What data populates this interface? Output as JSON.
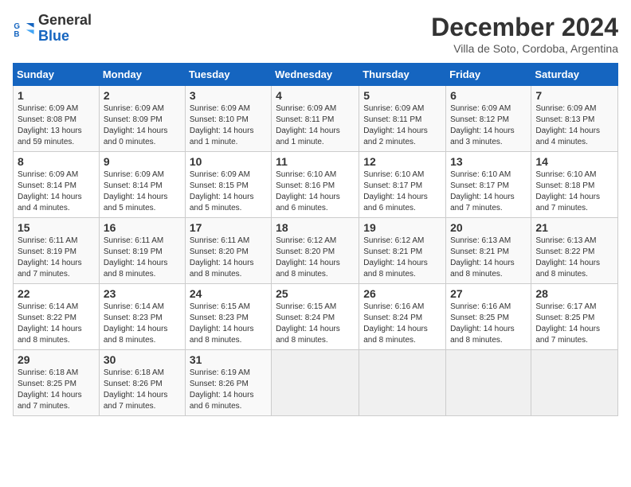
{
  "header": {
    "logo_line1": "General",
    "logo_line2": "Blue",
    "month_title": "December 2024",
    "subtitle": "Villa de Soto, Cordoba, Argentina"
  },
  "calendar": {
    "days_of_week": [
      "Sunday",
      "Monday",
      "Tuesday",
      "Wednesday",
      "Thursday",
      "Friday",
      "Saturday"
    ],
    "weeks": [
      [
        null,
        null,
        null,
        null,
        null,
        null,
        null
      ]
    ],
    "cells": [
      {
        "day": null
      },
      {
        "day": null
      },
      {
        "day": null
      },
      {
        "day": null
      },
      {
        "day": null
      },
      {
        "day": null
      },
      {
        "day": null
      }
    ]
  },
  "days": {
    "w1": [
      null,
      null,
      null,
      null,
      null,
      null,
      null
    ]
  }
}
